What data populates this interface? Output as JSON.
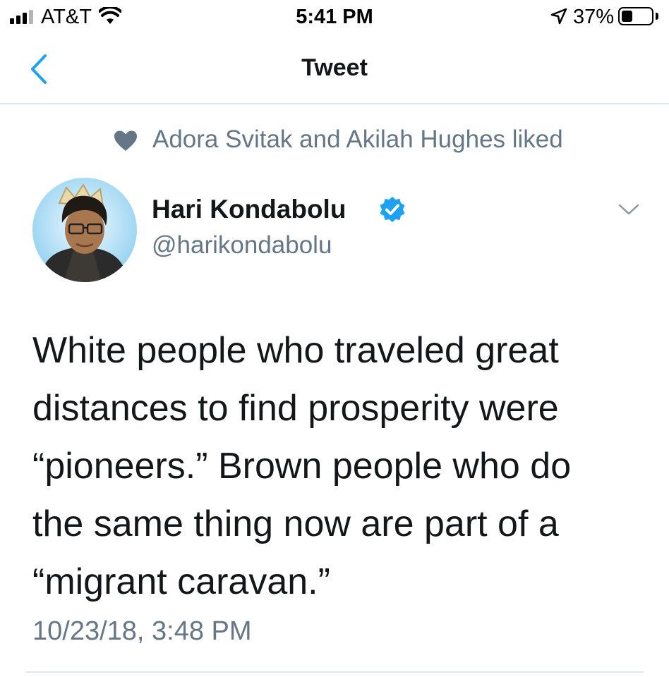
{
  "status_bar": {
    "carrier": "AT&T",
    "time": "5:41 PM",
    "battery_percent": "37%",
    "battery_level": 0.37
  },
  "nav": {
    "title": "Tweet",
    "back_icon": "chevron-left-icon"
  },
  "social_context": {
    "text": "Adora Svitak and Akilah Hughes liked",
    "icon": "heart-icon"
  },
  "tweet": {
    "author_name": "Hari Kondabolu",
    "handle": "@harikondabolu",
    "verified": true,
    "text": "White people who traveled great\ndistances to find prosperity were\n“pioneers.” Brown people who do\nthe same thing now are part of a\n“migrant caravan.”",
    "timestamp": "10/23/18, 3:48 PM"
  },
  "colors": {
    "accent": "#1da1f2",
    "secondary_text": "#657786",
    "primary_text": "#14171a",
    "divider": "#e1e8ed"
  }
}
